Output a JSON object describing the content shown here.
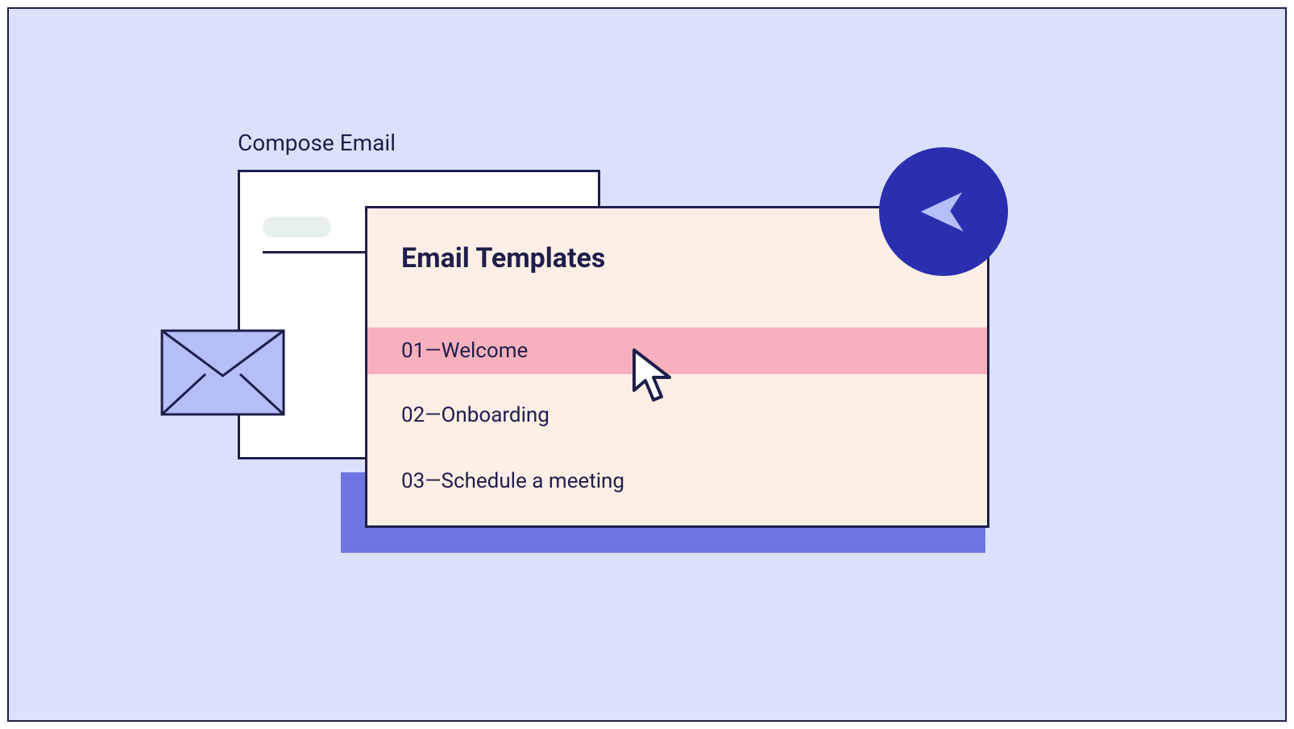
{
  "compose": {
    "label": "Compose Email"
  },
  "templates": {
    "title": "Email Templates",
    "items": [
      "01—Welcome",
      "02—Onboarding",
      "03—Schedule a meeting"
    ]
  },
  "icons": {
    "send": "send-icon",
    "envelope": "envelope-icon",
    "cursor": "cursor-icon"
  }
}
